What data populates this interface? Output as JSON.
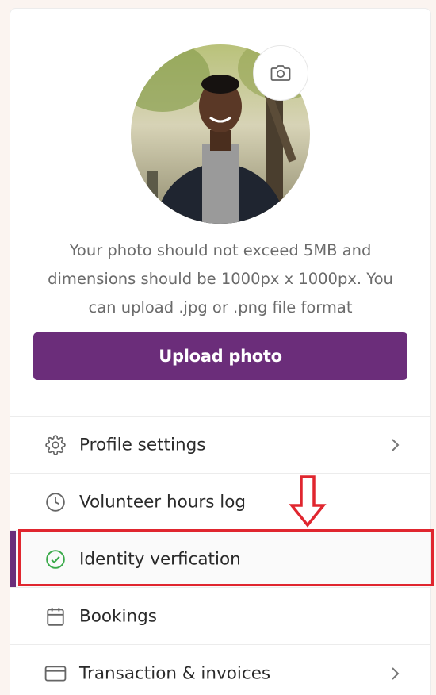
{
  "profile": {
    "camera_icon": "camera-icon",
    "photo_hint": "Your photo should not exceed 5MB and dimensions should be 1000px x 1000px. You can upload .jpg or .png file format",
    "upload_label": "Upload photo"
  },
  "menu": {
    "items": [
      {
        "label": "Profile settings",
        "icon": "gear-icon",
        "chevron": true
      },
      {
        "label": "Volunteer hours log",
        "icon": "clock-icon",
        "chevron": false
      },
      {
        "label": "Identity verfication",
        "icon": "check-circle-icon",
        "chevron": false,
        "active": true
      },
      {
        "label": "Bookings",
        "icon": "calendar-icon",
        "chevron": false
      },
      {
        "label": "Transaction & invoices",
        "icon": "card-icon",
        "chevron": true
      }
    ]
  },
  "colors": {
    "brand": "#6b2d7a",
    "success": "#3aaa4a",
    "highlight": "#e0262f"
  }
}
